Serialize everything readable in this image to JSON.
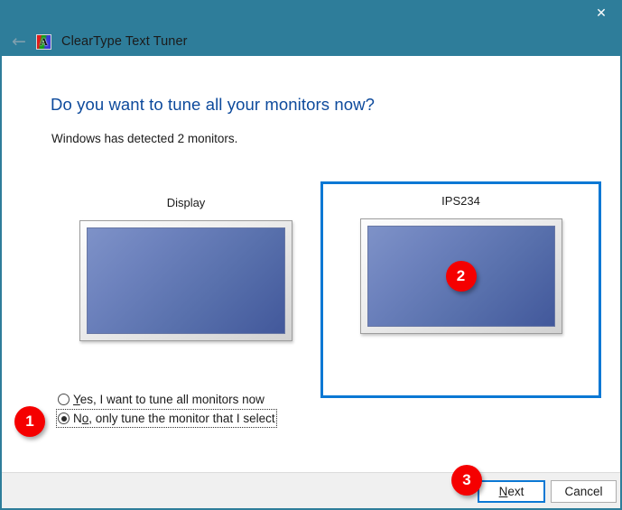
{
  "window": {
    "title": "ClearType Text Tuner",
    "app_icon": "cleartype-a-icon",
    "back_icon": "back-arrow-icon",
    "close_icon": "close-icon",
    "close_glyph": "✕",
    "back_glyph": "←",
    "icon_letter": "A",
    "titlebar_color": "#2e7d9a"
  },
  "content": {
    "heading": "Do you want to tune all your monitors now?",
    "subtext": "Windows has detected 2 monitors.",
    "heading_color": "#0d4a9c"
  },
  "monitors": [
    {
      "label": "Display",
      "selected": false,
      "badge": null
    },
    {
      "label": "IPS234",
      "selected": true,
      "badge": "2"
    }
  ],
  "options": [
    {
      "pre": "",
      "mnemonic": "Y",
      "post": "es, I want to tune all monitors now",
      "selected": false,
      "focused": false
    },
    {
      "pre": "N",
      "mnemonic": "o",
      "post": ", only tune the monitor that I select",
      "selected": true,
      "focused": true
    }
  ],
  "footer": {
    "next": {
      "pre": "",
      "mnemonic": "N",
      "post": "ext",
      "default": true
    },
    "cancel": {
      "label": "Cancel"
    }
  },
  "badges": {
    "one": "1",
    "three": "3",
    "color": "#f50000"
  },
  "selection_color": "#0b78d4"
}
